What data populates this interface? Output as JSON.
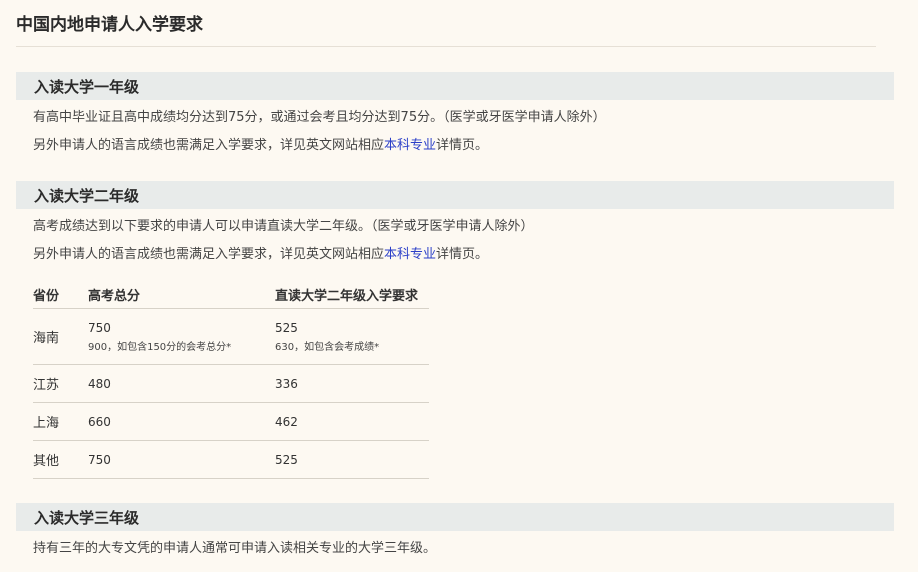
{
  "page": {
    "title": "中国内地申请人入学要求"
  },
  "sections": [
    {
      "heading": "入读大学一年级",
      "lines": [
        "有高中毕业证且高中成绩均分达到75分，或通过会考且均分达到75分。（医学或牙医学申请人除外）"
      ],
      "lang_line": {
        "before": "另外申请人的语言成绩也需满足入学要求，详见英文网站相应",
        "link": "本科专业",
        "after": "详情页。"
      }
    },
    {
      "heading": "入读大学二年级",
      "lines": [
        "高考成绩达到以下要求的申请人可以申请直读大学二年级。（医学或牙医学申请人除外）"
      ],
      "lang_line": {
        "before": "另外申请人的语言成绩也需满足入学要求，详见英文网站相应",
        "link": "本科专业",
        "after": "详情页。"
      }
    },
    {
      "heading": "入读大学三年级",
      "lines": [
        "持有三年的大专文凭的申请人通常可申请入读相关专业的大学三年级。"
      ]
    }
  ],
  "table": {
    "headers": [
      "省份",
      "高考总分",
      "直读大学二年级入学要求"
    ],
    "rows": [
      {
        "province": "海南",
        "total": "750",
        "total_note": "900，如包含150分的会考总分*",
        "req": "525",
        "req_note": "630，如包含会考成绩*"
      },
      {
        "province": "江苏",
        "total": "480",
        "req": "336"
      },
      {
        "province": "上海",
        "total": "660",
        "req": "462"
      },
      {
        "province": "其他",
        "total": "750",
        "req": "525"
      }
    ]
  }
}
